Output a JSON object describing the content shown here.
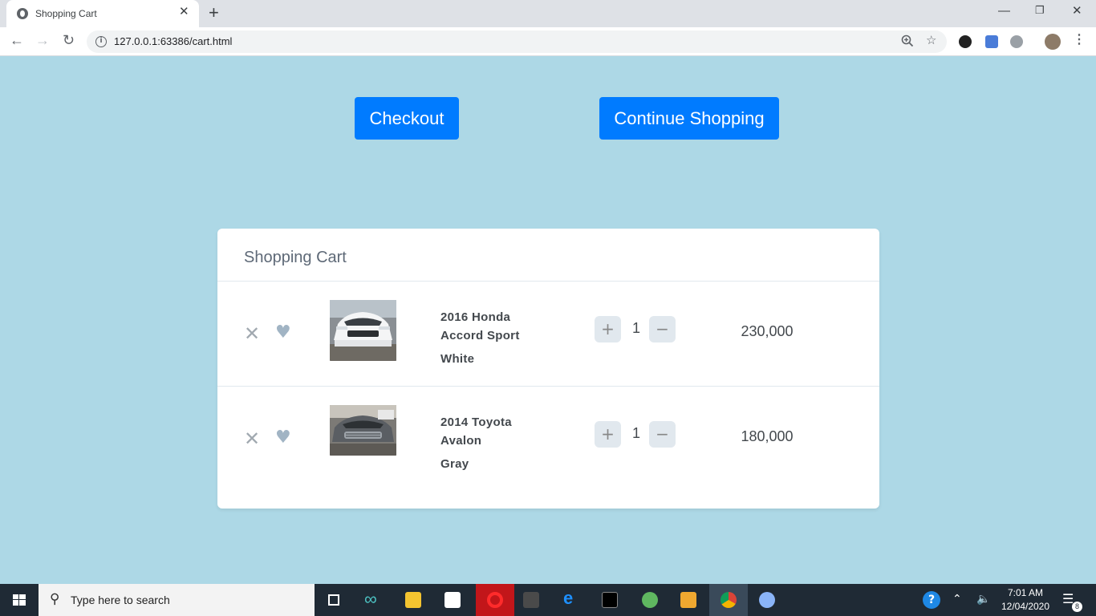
{
  "browser": {
    "tab_title": "Shopping Cart",
    "url": "127.0.0.1:63386/cart.html"
  },
  "page": {
    "checkout_label": "Checkout",
    "continue_label": "Continue Shopping",
    "cart_title": "Shopping Cart",
    "items": [
      {
        "line1": "2016 Honda",
        "line2": "Accord Sport",
        "color": "White",
        "qty": "1",
        "price": "230,000"
      },
      {
        "line1": "2014 Toyota",
        "line2": "Avalon",
        "color": "Gray",
        "qty": "1",
        "price": "180,000"
      }
    ]
  },
  "taskbar": {
    "search_placeholder": "Type here to search",
    "time": "7:01 AM",
    "date": "12/04/2020",
    "notification_count": "8"
  },
  "colors": {
    "page_background": "#add8e6",
    "primary_button": "#007bff"
  }
}
